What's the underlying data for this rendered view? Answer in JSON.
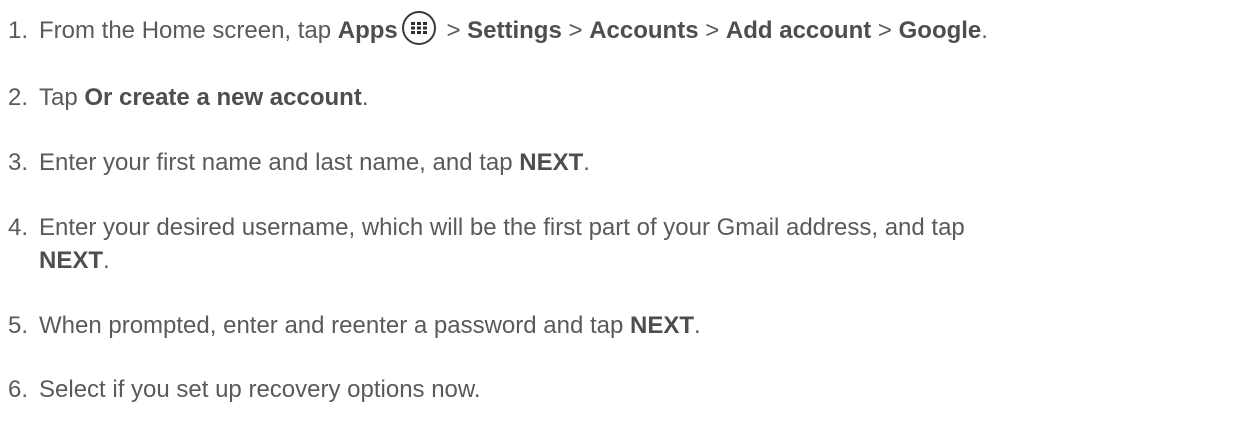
{
  "steps": [
    {
      "number": "1.",
      "t1": "From the Home screen, tap ",
      "apps": "Apps",
      "t2": " > ",
      "settings": "Settings",
      "t3": " > ",
      "accounts": "Accounts",
      "t4": " > ",
      "add_account": "Add account",
      "t5": " > ",
      "google": "Google",
      "t6": ".",
      "icon": "apps-grid-icon"
    },
    {
      "number": "2.",
      "t1": "Tap ",
      "bold": "Or create a new account",
      "t2": "."
    },
    {
      "number": "3.",
      "t1": "Enter your first name and last name, and tap ",
      "bold": "NEXT",
      "t2": "."
    },
    {
      "number": "4.",
      "t1": "Enter your desired username, which will be the first part of your Gmail address, and tap",
      "bold": "NEXT",
      "t2": "."
    },
    {
      "number": "5.",
      "t1": "When prompted, enter and reenter a password and tap ",
      "bold": "NEXT",
      "t2": "."
    },
    {
      "number": "6.",
      "t1": "Select if you set up recovery options now."
    }
  ]
}
